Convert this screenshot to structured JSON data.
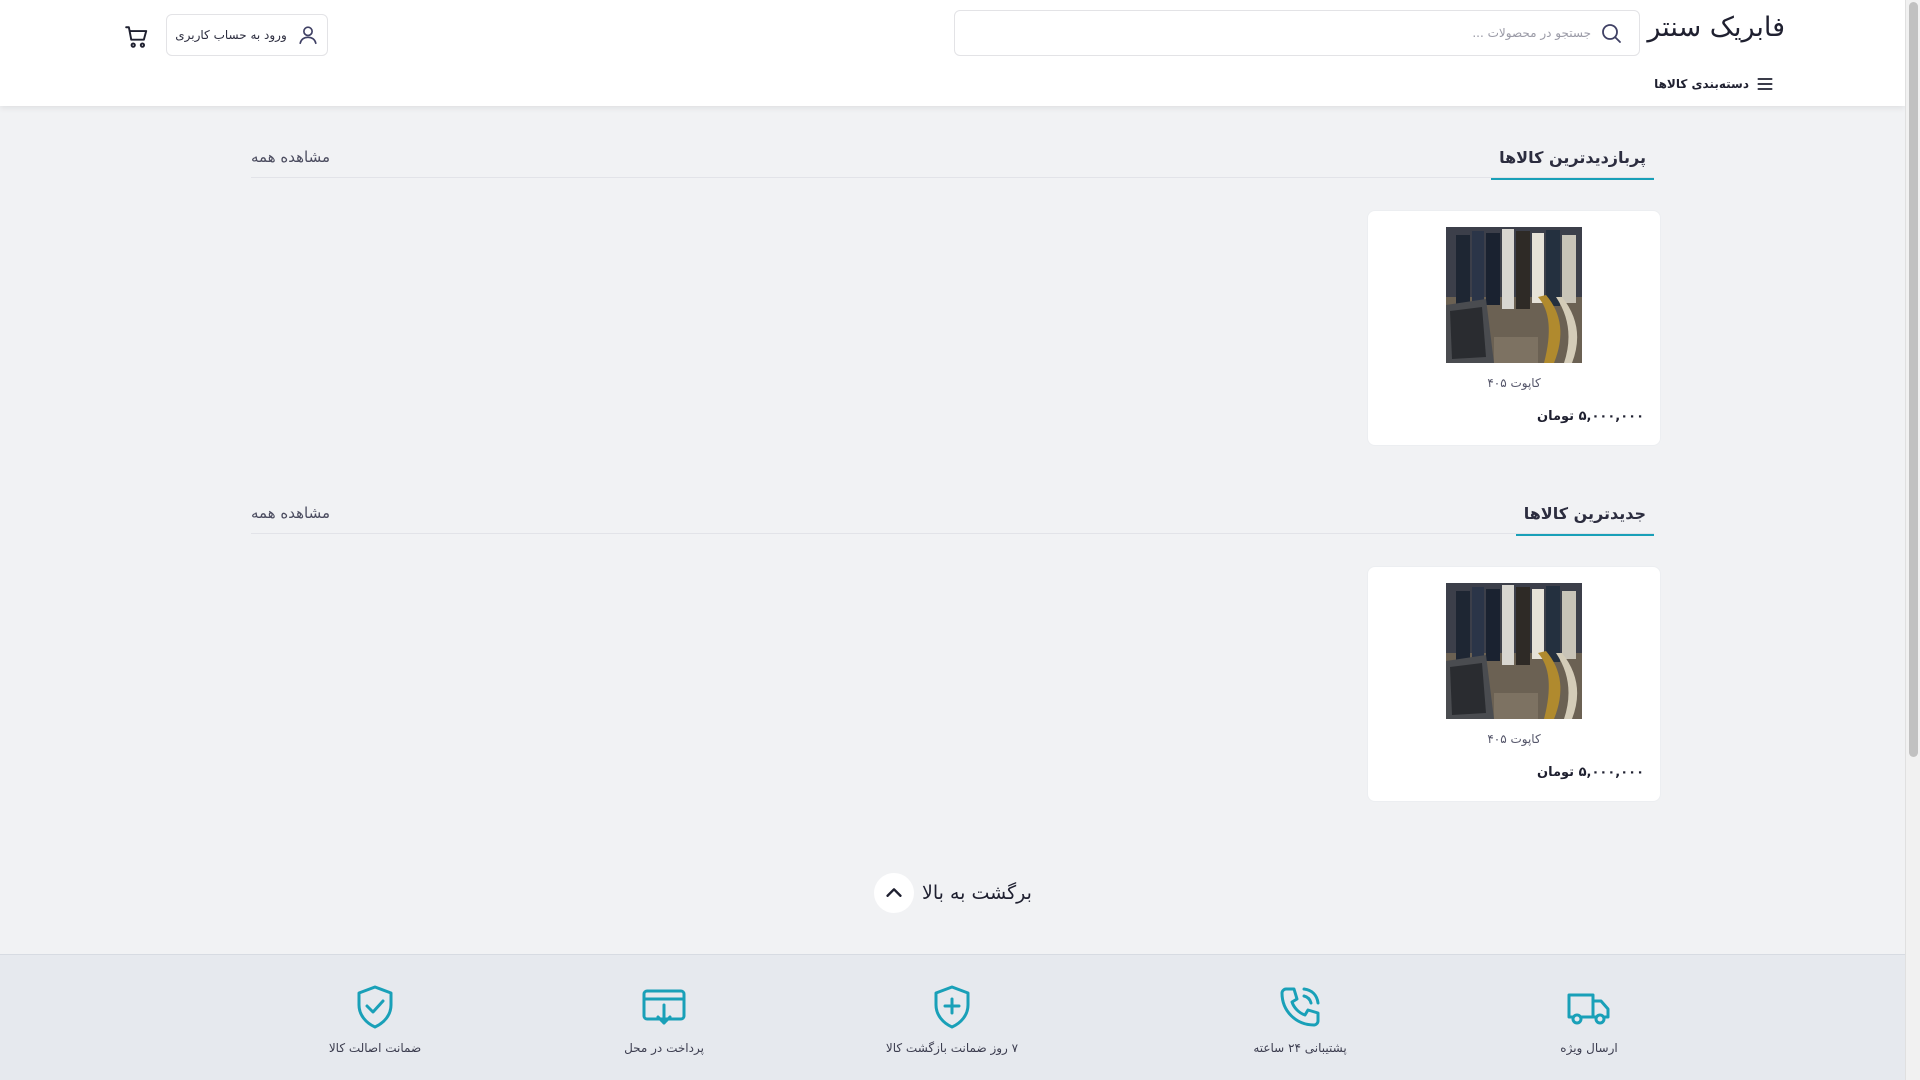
{
  "header": {
    "logo": "فابریک سنتر",
    "search_placeholder": "جستجو در محصولات ...",
    "login_label": "ورود به حساب کاربری",
    "categories_label": "دسته‌بندی کالاها"
  },
  "sections": [
    {
      "title": "پربازدیدترین کالاها",
      "view_all": "مشاهده همه",
      "products": [
        {
          "name": "کاپوت ۴۰۵",
          "price": "۵,۰۰۰,۰۰۰ تومان"
        }
      ]
    },
    {
      "title": "جدیدترین کالاها",
      "view_all": "مشاهده همه",
      "products": [
        {
          "name": "کاپوت ۴۰۵",
          "price": "۵,۰۰۰,۰۰۰ تومان"
        }
      ]
    }
  ],
  "back_to_top": "برگشت به بالا",
  "features": [
    {
      "label": "ارسال ویژه",
      "icon": "truck-icon"
    },
    {
      "label": "پشتیبانی ۲۴ ساعته",
      "icon": "phone-icon"
    },
    {
      "label": "۷ روز ضمانت بازگشت کالا",
      "icon": "shield-plus-icon"
    },
    {
      "label": "پرداخت در محل",
      "icon": "payment-icon"
    },
    {
      "label": "ضمانت اصالت کالا",
      "icon": "shield-check-icon"
    }
  ],
  "colors": {
    "accent": "#19a0b8",
    "background": "#f1f2f4",
    "footer_band": "#e6e9ee"
  }
}
